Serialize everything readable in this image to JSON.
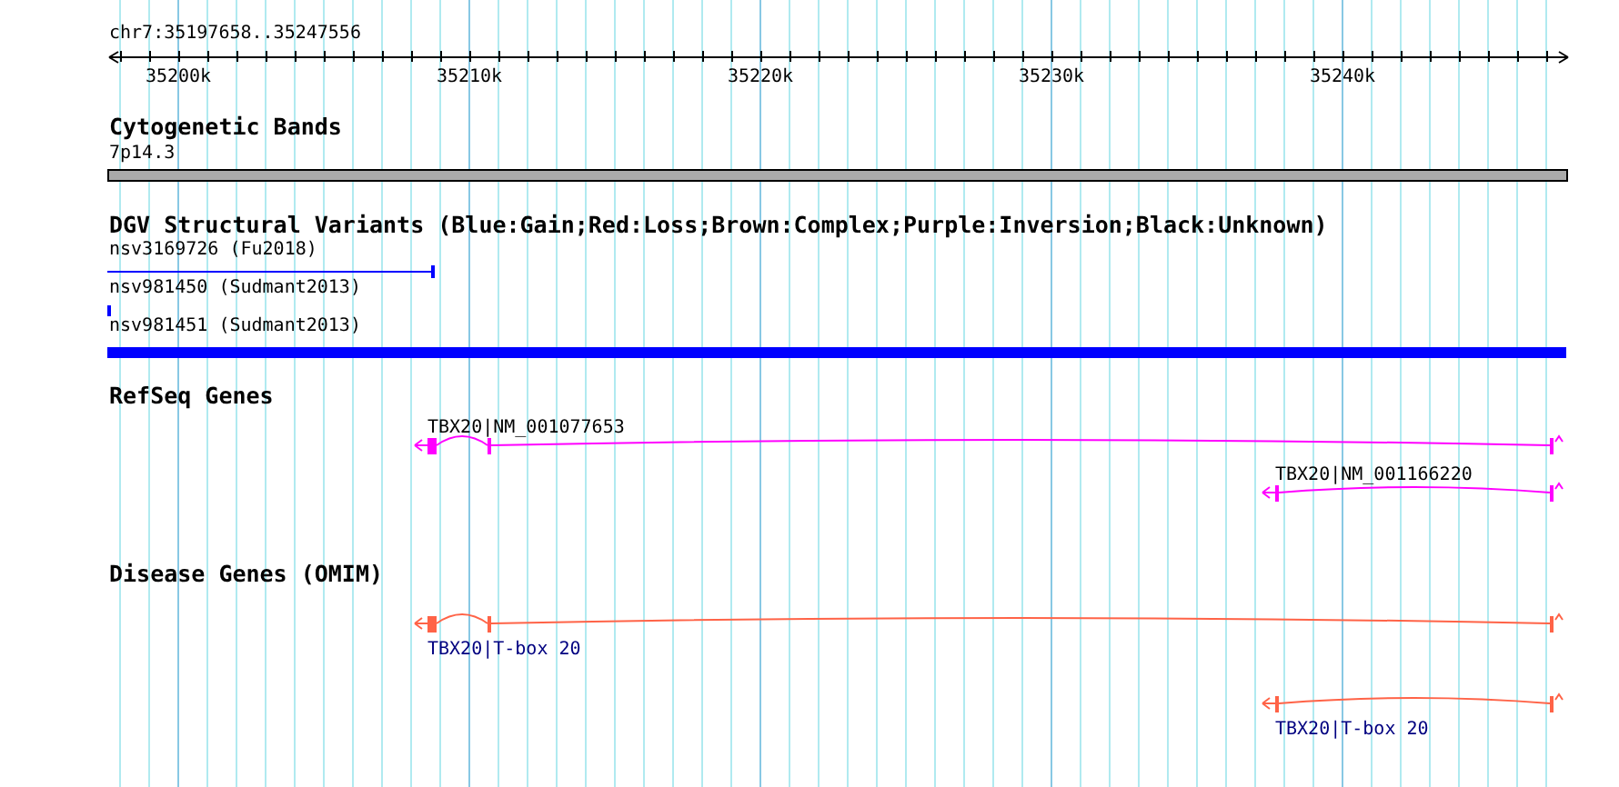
{
  "ruler": {
    "location": "chr7:35197658..35247556",
    "ticks": [
      "35200k",
      "35210k",
      "35220k",
      "35230k",
      "35240k"
    ]
  },
  "tracks": [
    {
      "kind": "band",
      "title": "Cytogenetic Bands",
      "color": "#aaaaaa",
      "features": [
        {
          "label": "7p14.3"
        }
      ]
    },
    {
      "kind": "variant",
      "title": "DGV Structural Variants (Blue:Gain;Red:Loss;Brown:Complex;Purple:Inversion;Black:Unknown)",
      "color": "#0000ff",
      "features": [
        {
          "label": "nsv3169726 (Fu2018)"
        },
        {
          "label": "nsv981450 (Sudmant2013)"
        },
        {
          "label": "nsv981451 (Sudmant2013)"
        }
      ]
    },
    {
      "kind": "refseq",
      "title": "RefSeq Genes",
      "color": "#ff00ff",
      "features": [
        {
          "label": "TBX20|NM_001077653"
        },
        {
          "label": "TBX20|NM_001166220"
        }
      ]
    },
    {
      "kind": "omim",
      "title": "Disease Genes (OMIM)",
      "color": "#ff6347",
      "features": [
        {
          "label": "TBX20|T-box 20"
        },
        {
          "label": "TBX20|T-box 20"
        }
      ]
    }
  ]
}
